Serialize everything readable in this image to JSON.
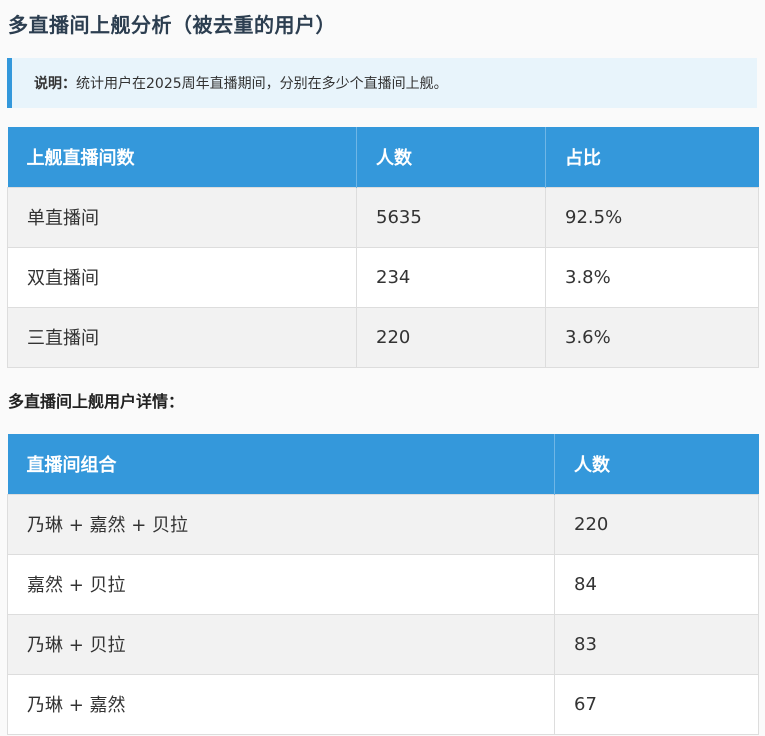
{
  "title": "多直播间上舰分析（被去重的用户）",
  "note": {
    "label": "说明：",
    "text": "统计用户在2025周年直播期间，分别在多少个直播间上舰。"
  },
  "table1": {
    "headers": [
      "上舰直播间数",
      "人数",
      "占比"
    ],
    "rows": [
      [
        "单直播间",
        "5635",
        "92.5%"
      ],
      [
        "双直播间",
        "234",
        "3.8%"
      ],
      [
        "三直播间",
        "220",
        "3.6%"
      ]
    ]
  },
  "subheading": "多直播间上舰用户详情：",
  "table2": {
    "headers": [
      "直播间组合",
      "人数"
    ],
    "rows": [
      [
        "乃琳 + 嘉然 + 贝拉",
        "220"
      ],
      [
        "嘉然 + 贝拉",
        "84"
      ],
      [
        "乃琳 + 贝拉",
        "83"
      ],
      [
        "乃琳 + 嘉然",
        "67"
      ]
    ]
  }
}
